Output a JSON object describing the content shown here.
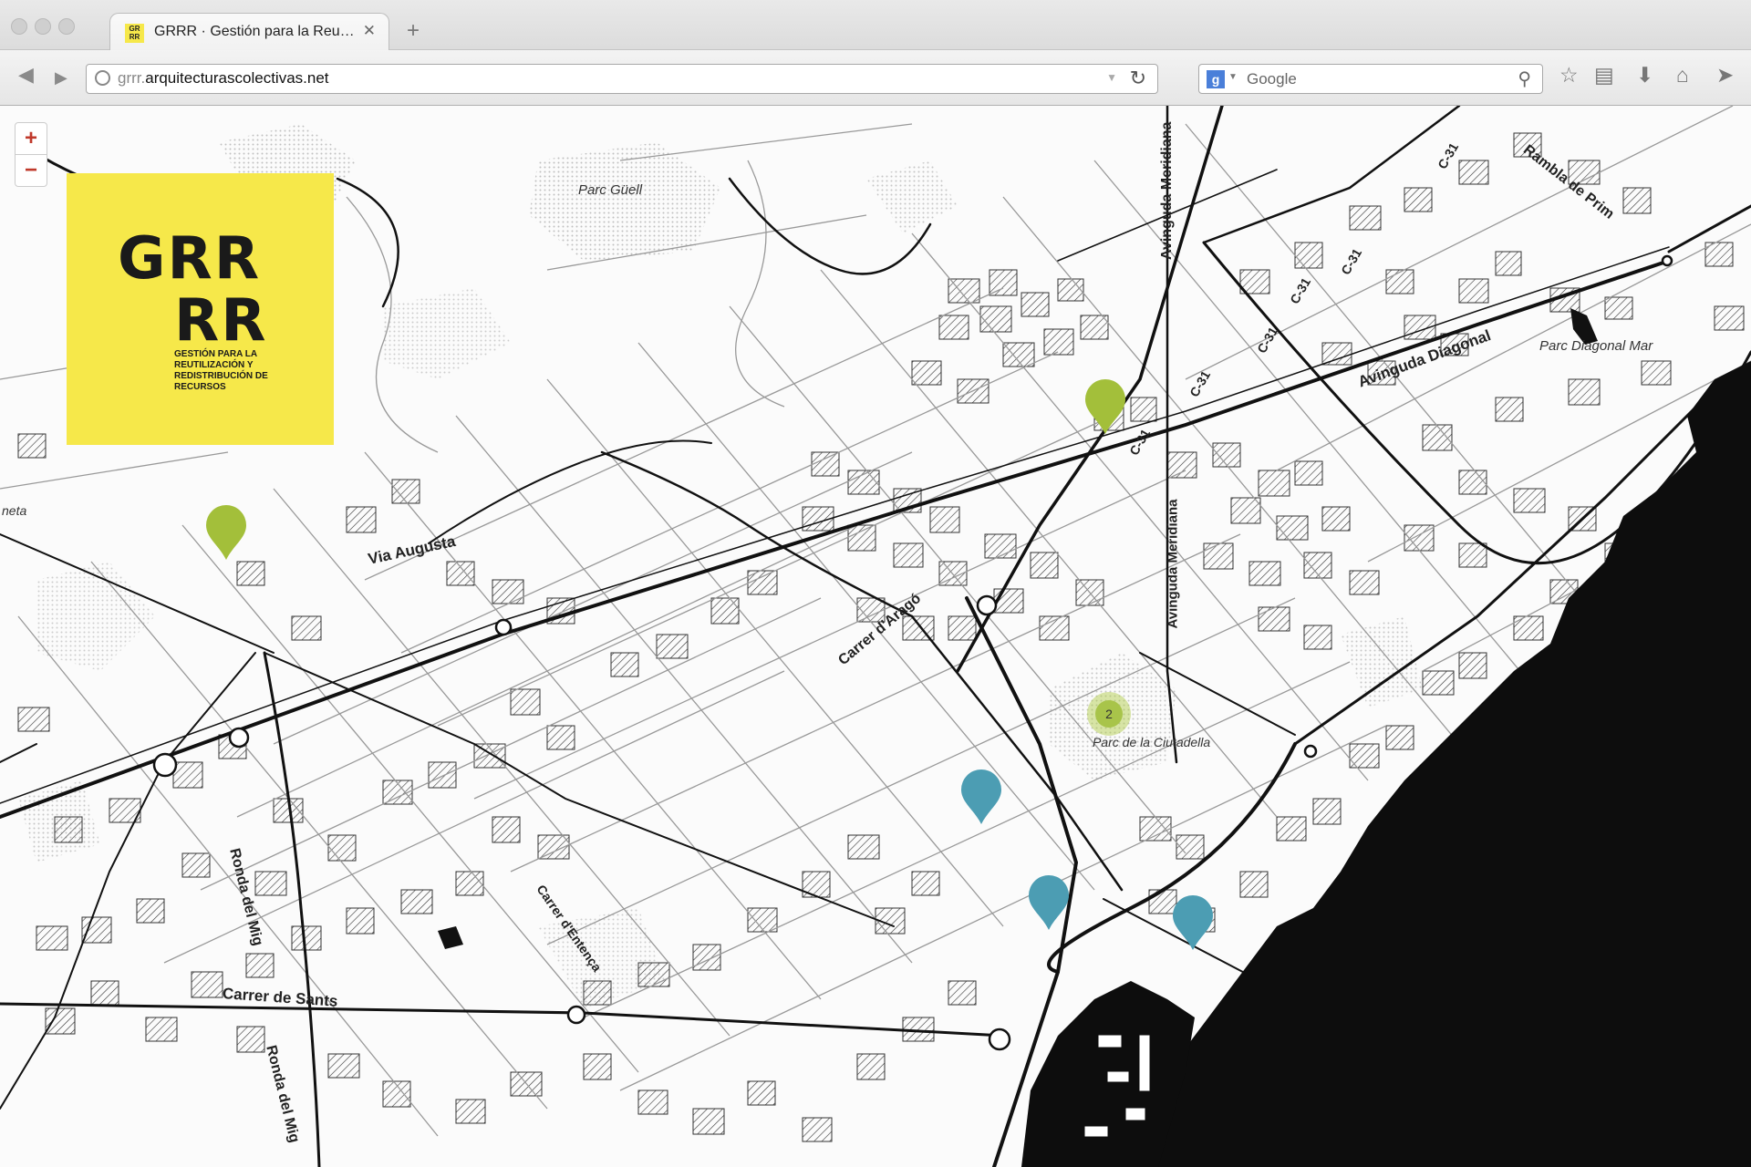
{
  "browser": {
    "tab_title": "GRRR · Gestión para la Reu…",
    "favicon_text": "GR RR",
    "url_dim": "grrr.",
    "url_host": "arquitecturascolectivas.net",
    "search_placeholder": "Google"
  },
  "map": {
    "zoom_in": "+",
    "zoom_out": "−",
    "logo": {
      "line1": "GRR",
      "line2": "RR",
      "subtitle": "GESTIÓN PARA LA REUTILIZACIÓN Y REDISTRIBUCIÓN DE RECURSOS",
      "color": "#f6e84a"
    },
    "labels": {
      "parc_guell": "Parc Güell",
      "avinguda_meridiana_top": "Avinguda Meridiana",
      "avinguda_meridiana": "Avinguda Meridiana",
      "c31_a": "C-31",
      "c31_b": "C-31",
      "c31_c": "C-31",
      "c31_d": "C-31",
      "c31_e": "C-31",
      "c31_f": "C-31",
      "rambla_prim": "Rambla de Prim",
      "avinguda_diagonal": "Avinguda Diagonal",
      "parc_diagonal_mar": "Parc Diagonal Mar",
      "via_augusta": "Via Augusta",
      "carrer_arago": "Carrer d'Aragó",
      "parc_ciutadella": "Parc de la Ciutadella",
      "carrer_entenca": "Carrer d'Entença",
      "carrer_sants": "Carrer de Sants",
      "ronda_mig_a": "Ronda del Mig",
      "ronda_mig_b": "Ronda del Mig",
      "neta": "neta"
    },
    "cluster_count": "2",
    "colors": {
      "green_marker": "#a3bf3a",
      "blue_marker": "#4c9db3",
      "sea": "#0d0d0d"
    }
  }
}
